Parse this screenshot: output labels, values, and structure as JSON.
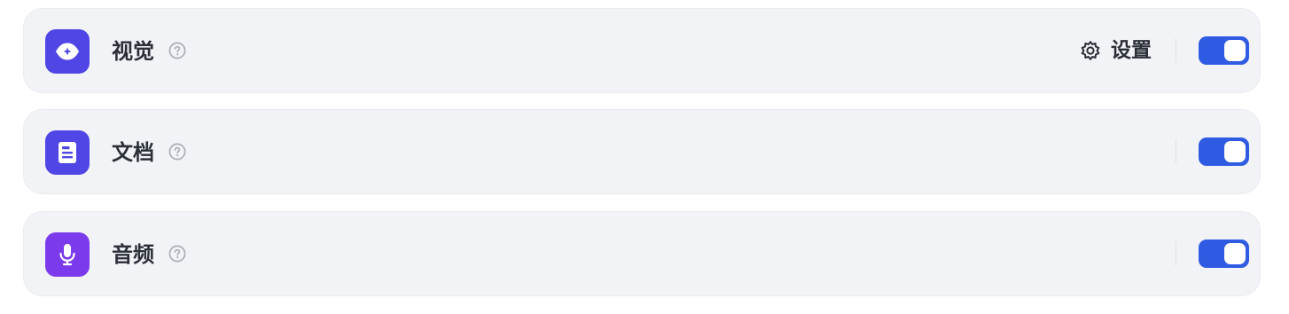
{
  "colors": {
    "row_background": "#f2f3f7",
    "toggle_on": "#2f5be3",
    "vision_icon_bg": "#4f46e5",
    "document_icon_bg": "#4f46e5",
    "audio_icon_bg": "#7c3aed",
    "title_text": "#2b2f38",
    "help_icon": "#a9adb6"
  },
  "capabilities": [
    {
      "id": "vision",
      "title": "视觉",
      "icon": "eye-icon",
      "help_icon": "question-circle-icon",
      "has_settings": true,
      "settings_label": "设置",
      "settings_icon": "gear-icon",
      "enabled": true
    },
    {
      "id": "document",
      "title": "文档",
      "icon": "document-icon",
      "help_icon": "question-circle-icon",
      "has_settings": false,
      "enabled": true
    },
    {
      "id": "audio",
      "title": "音频",
      "icon": "microphone-icon",
      "help_icon": "question-circle-icon",
      "has_settings": false,
      "enabled": true
    }
  ]
}
